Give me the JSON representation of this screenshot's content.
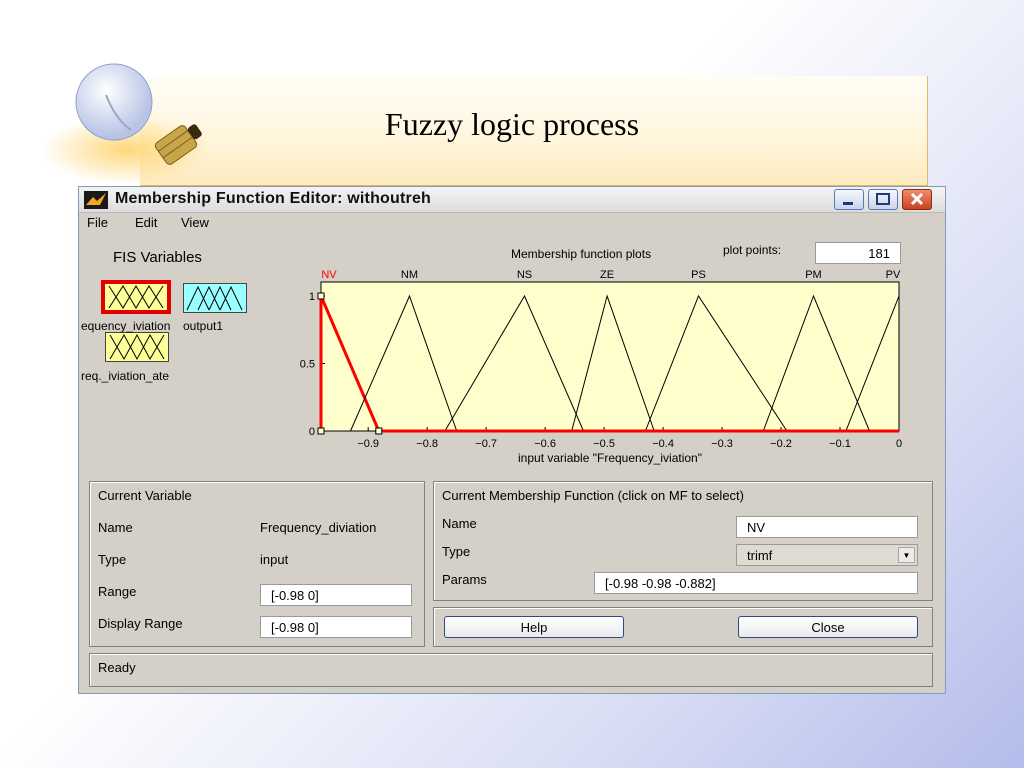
{
  "slide": {
    "title": "Fuzzy logic process"
  },
  "window": {
    "title": "Membership Function Editor: withoutreh",
    "menu": [
      "File",
      "Edit",
      "View"
    ]
  },
  "fis": {
    "title": "FIS Variables",
    "variables": [
      "equency_iviation",
      "output1",
      "req._iviation_ate"
    ]
  },
  "plot": {
    "title": "Membership function plots",
    "plot_points_label": "plot points:",
    "plot_points_value": "181"
  },
  "chart_data": {
    "type": "line",
    "title": "",
    "xlabel": "input variable \"Frequency_iviation\"",
    "ylabel": "",
    "xlim": [
      -0.98,
      0
    ],
    "ylim": [
      0,
      1
    ],
    "x_ticks": [
      -0.9,
      -0.8,
      -0.7,
      -0.6,
      -0.5,
      -0.4,
      -0.3,
      -0.2,
      -0.1,
      0
    ],
    "x_tick_labels": [
      "−0.9",
      "−0.8",
      "−0.7",
      "−0.6",
      "−0.5",
      "−0.4",
      "−0.3",
      "−0.2",
      "−0.1",
      "0"
    ],
    "y_ticks": [
      0,
      0.5,
      1
    ],
    "y_tick_labels": [
      "0",
      "0.5",
      "1"
    ],
    "grid": false,
    "selected_color": "#ff0000",
    "series": [
      {
        "name": "NV",
        "params": [
          -0.98,
          -0.98,
          -0.882
        ],
        "selected": true
      },
      {
        "name": "NM",
        "params": [
          -0.93,
          -0.83,
          -0.75
        ]
      },
      {
        "name": "NS",
        "params": [
          -0.77,
          -0.635,
          -0.535
        ]
      },
      {
        "name": "ZE",
        "params": [
          -0.555,
          -0.495,
          -0.415
        ]
      },
      {
        "name": "PS",
        "params": [
          -0.43,
          -0.34,
          -0.19
        ]
      },
      {
        "name": "PM",
        "params": [
          -0.23,
          -0.145,
          -0.05
        ]
      },
      {
        "name": "PV",
        "params": [
          -0.09,
          0,
          0
        ]
      }
    ]
  },
  "current_variable": {
    "header": "Current Variable",
    "name_label": "Name",
    "name_value": "Frequency_diviation",
    "type_label": "Type",
    "type_value": "input",
    "range_label": "Range",
    "range_value": "[-0.98 0]",
    "display_range_label": "Display Range",
    "display_range_value": "[-0.98 0]"
  },
  "current_mf": {
    "header": "Current Membership Function (click on MF to select)",
    "name_label": "Name",
    "name_value": "NV",
    "type_label": "Type",
    "type_value": "trimf",
    "params_label": "Params",
    "params_value": "[-0.98 -0.98 -0.882]"
  },
  "buttons": {
    "help": "Help",
    "close": "Close"
  },
  "status": "Ready"
}
